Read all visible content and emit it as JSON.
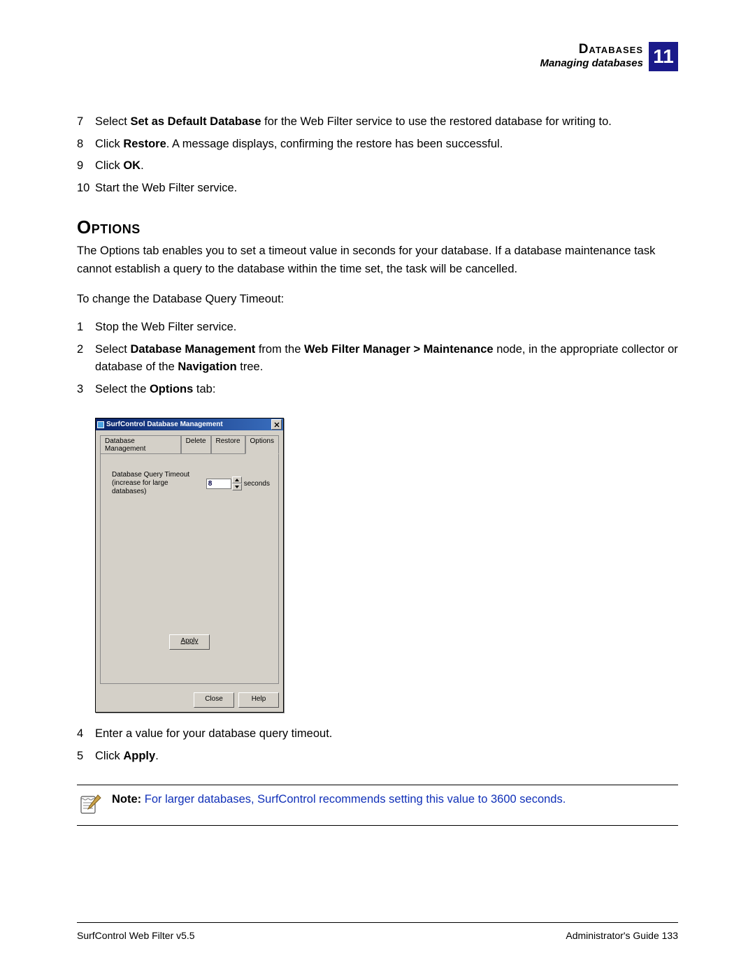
{
  "header": {
    "title": "Databases",
    "subtitle": "Managing databases",
    "chapter": "11"
  },
  "steps_a": [
    {
      "n": "7",
      "pre": "Select ",
      "bold": "Set as Default Database",
      "post": " for the Web Filter service to use the restored database for writing to."
    },
    {
      "n": "8",
      "pre": "Click ",
      "bold": "Restore",
      "post": ". A message displays, confirming the restore has been successful."
    },
    {
      "n": "9",
      "pre": "Click ",
      "bold": "OK",
      "post": "."
    },
    {
      "n": "10",
      "pre": "Start the Web Filter service.",
      "bold": "",
      "post": ""
    }
  ],
  "section_heading": "Options",
  "options_intro": "The Options tab enables you to set a timeout value in seconds for your database. If a database maintenance task cannot establish a query to the database within the time set, the task will be cancelled.",
  "options_to_change": "To change the Database Query Timeout:",
  "dlg": {
    "title": "SurfControl Database Management",
    "tabs": [
      "Database Management",
      "Delete",
      "Restore",
      "Options"
    ],
    "selected_tab": "Options",
    "field_label_1": "Database Query Timeout",
    "field_label_2": "(increase for large databases)",
    "value": "8",
    "unit": "seconds",
    "apply": "Apply",
    "close": "Close",
    "help": "Help"
  },
  "steps_b_1": {
    "n": "1",
    "text": "Stop the Web Filter service."
  },
  "steps_b_2": {
    "n": "2",
    "pre": "Select ",
    "b1": "Database Management",
    "mid1": " from the ",
    "b2": "Web Filter Manager > Maintenance",
    "mid2": " node, in the appropriate collector or database of the ",
    "b3": "Navigation",
    "post": " tree."
  },
  "steps_b_3": {
    "n": "3",
    "pre": "Select the ",
    "b": "Options",
    "post": " tab:"
  },
  "steps_b_4": {
    "n": "4",
    "text": "Enter a value for your database query timeout."
  },
  "steps_b_5": {
    "n": "5",
    "pre": "Click ",
    "b": "Apply",
    "post": "."
  },
  "note": {
    "label": "Note:",
    "body": " For larger databases, SurfControl recommends setting this value to 3600 seconds."
  },
  "footer": {
    "left": "SurfControl Web Filter v5.5",
    "right": "Administrator's Guide  133"
  }
}
